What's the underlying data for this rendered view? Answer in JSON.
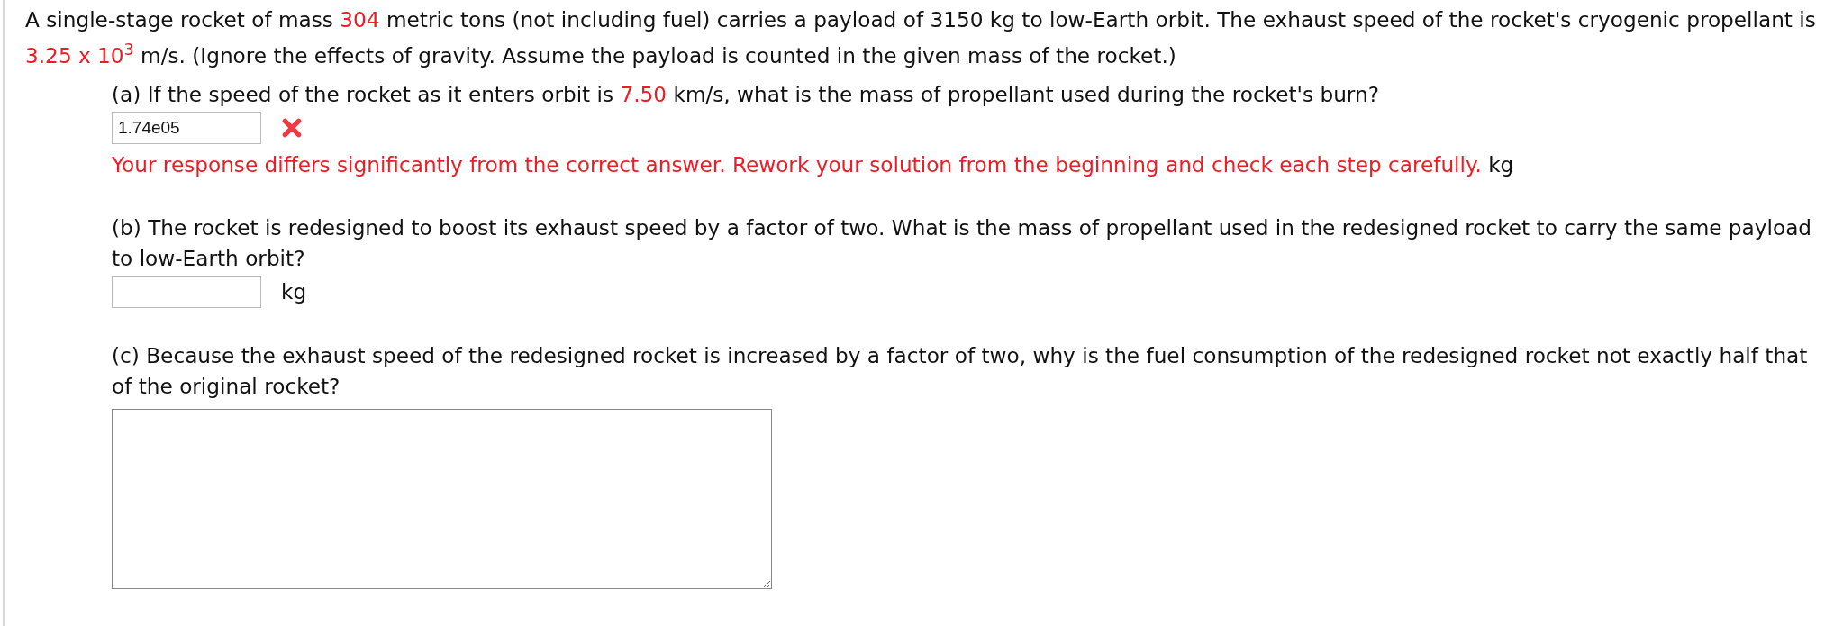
{
  "intro": [
    {
      "text": "A single-stage rocket of mass ",
      "highlighted": false
    },
    {
      "text": "304",
      "highlighted": true
    },
    {
      "text": " metric tons (not including fuel) carries a payload of 3150 kg to low-Earth orbit. The exhaust speed of the rocket's cryogenic propellant is ",
      "highlighted": false
    },
    {
      "text": "3.25 x 10$^{3}$",
      "highlighted": true
    },
    {
      "text": " m/s. (Ignore the effects of gravity. Assume the payload is counted in the given mass of the rocket.)",
      "highlighted": false
    }
  ],
  "parts": [
    {
      "question": [
        {
          "text": "(a) If the speed of the rocket as it enters orbit is ",
          "highlighted": false
        },
        {
          "text": "7.50",
          "highlighted": true
        },
        {
          "text": " km/s, what is the mass of propellant used during the rocket's burn?",
          "highlighted": false
        }
      ],
      "answer": {
        "kind": "number",
        "value": "1.74e05",
        "correct": false
      },
      "feedback": "Your response differs significantly from the correct answer. Rework your solution from the beginning and check each step carefully.",
      "unit": "kg"
    },
    {
      "question": [
        {
          "text": "(b) The rocket is redesigned to boost its exhaust speed by a factor of two. What is the mass of propellant used in the redesigned rocket to carry the same payload to low-Earth orbit?",
          "highlighted": false
        }
      ],
      "answer": {
        "kind": "number"
      },
      "unit": "kg"
    },
    {
      "question": [
        {
          "text": "(c) Because the exhaust speed of the redesigned rocket is increased by a factor of two, why is the fuel consumption of the redesigned rocket not exactly half that of the original rocket?",
          "highlighted": false
        }
      ],
      "answer": {
        "kind": "essay"
      }
    }
  ]
}
